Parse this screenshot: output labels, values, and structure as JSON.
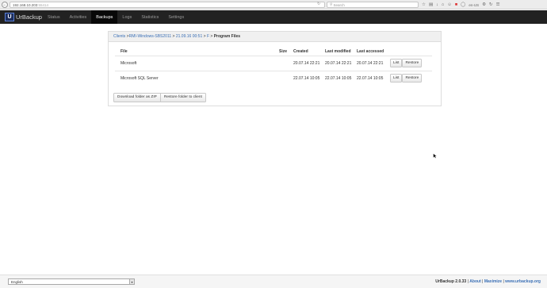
{
  "browser": {
    "url_host": "192.168.10.203",
    "url_port": ":55414",
    "search_placeholder": "Search",
    "locale": "en-US"
  },
  "navbar": {
    "brand": "UrBackup",
    "logo_letter": "U",
    "items": [
      "Status",
      "Activities",
      "Backups",
      "Logs",
      "Statistics",
      "Settings"
    ],
    "active": "Backups"
  },
  "breadcrumb": {
    "clients": "Clients",
    "client": "RMI-Windows-SBS2011",
    "backup": "21.09.16 00:51",
    "drive": "F",
    "current": "Program Files"
  },
  "table": {
    "headers": {
      "file": "File",
      "size": "Size",
      "created": "Created",
      "modified": "Last modified",
      "accessed": "Last accessed"
    },
    "rows": [
      {
        "file": "Microsoft",
        "size": "",
        "created": "20.07.14 22:21",
        "modified": "20.07.14 22:21",
        "accessed": "20.07.14 22:21",
        "list": "List",
        "restore": "Restore"
      },
      {
        "file": "Microsoft SQL Server",
        "size": "",
        "created": "22.07.14 10:05",
        "modified": "22.07.14 10:05",
        "accessed": "22.07.14 10:05",
        "list": "List",
        "restore": "Restore"
      }
    ]
  },
  "actions": {
    "download_zip": "Download folder as ZIP",
    "restore_folder": "Restore folder to client"
  },
  "footer": {
    "language": "English",
    "version": "UrBackup 2.0.33",
    "about": "About",
    "maximize": "Maximize",
    "website": "www.urbackup.org"
  }
}
